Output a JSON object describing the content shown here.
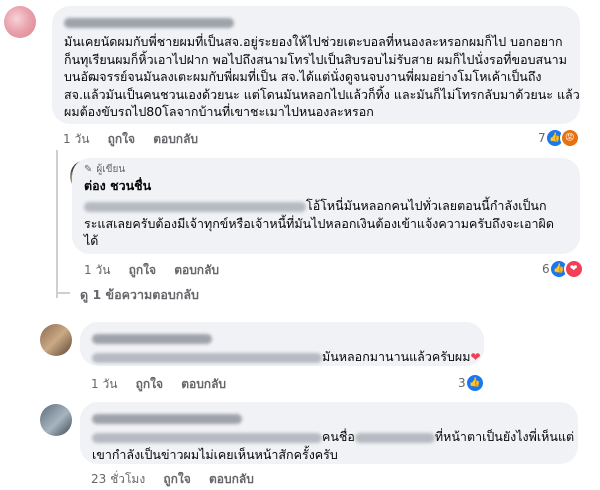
{
  "comments": [
    {
      "body": [
        "มันเคยนัดผมกับพี่ชายผมที่เป็นสจ.อยู่ระยองให้ไปช่วยเตะบอลที่หนองละหรอกผมก็ไป บอกอยาก",
        "ก็นทุเรียนผมก็หิ้วเอาไปฝาก พอไปถึงสนามโทรไปเป็นสิบรอบไม่รับสาย ผมก็ไปนั่งรอที่ขอบสนาม",
        "บนอัฒจรรย์จนมันลงเตะผมกับพี่ผมที่เป็น สจ.ได้แต่นั่งดูจนจบงานพี่ผมอย่างโมโหเค้าเป็นถึง",
        "สจ.แล้วมันเป็นคนชวนเองด้วยนะ แต่โดนมันหลอกไปแล้วก็ทิ้ง และมันก็ไม่โทรกลับมาด้วยนะ แล้ว",
        "ผมต้องขับรถไป80โลจากบ้านที่เขาชะเมาไปหนองละหรอก"
      ],
      "time": "1 วัน",
      "like": "ถูกใจ",
      "reply": "ตอบกลับ",
      "reaction_count": "7",
      "reactions": [
        "like-icon",
        "angry-icon"
      ]
    },
    {
      "author_badge": "ผู้เขียน",
      "name": "ต่อง ชวนชื่น",
      "body_suffix": "โอ้โหนี่มันหลอกคนไปทั่วเลยตอนนี้กำลังเป็นก",
      "body": [
        "ระแสเลยครับต้องมีเจ้าทุกข์หรือเจ้าหนี้ที่มันไปหลอกเงินต้องเข้าแจ้งความครับถึงจะเอาผิด",
        "ได้"
      ],
      "time": "1 วัน",
      "like": "ถูกใจ",
      "reply": "ตอบกลับ",
      "reaction_count": "6",
      "reactions": [
        "like-icon",
        "love-icon"
      ]
    },
    {
      "view_replies": "ดู 1 ข้อความตอบกลับ"
    },
    {
      "body_suffix": "มันหลอกมานานแล้วครับผม",
      "time": "1 วัน",
      "like": "ถูกใจ",
      "reply": "ตอบกลับ",
      "reaction_count": "3",
      "reactions": [
        "like-icon"
      ]
    },
    {
      "body_mid": "คนชื่อ",
      "body_suffix": "ที่หน้าตาเป็นยังไงพี่เห็นแต่",
      "body": [
        "เขากำลังเป็นข่าวผมไม่เคยเห็นหน้าสักครั้งครับ"
      ],
      "time": "23 ชั่วโมง",
      "like": "ถูกใจ",
      "reply": "ตอบกลับ"
    }
  ],
  "colors": {
    "bubble": "#f0f2f5",
    "like": "#1877f2",
    "love": "#f33e58",
    "angry": "#e9710f",
    "meta": "#65676b"
  }
}
